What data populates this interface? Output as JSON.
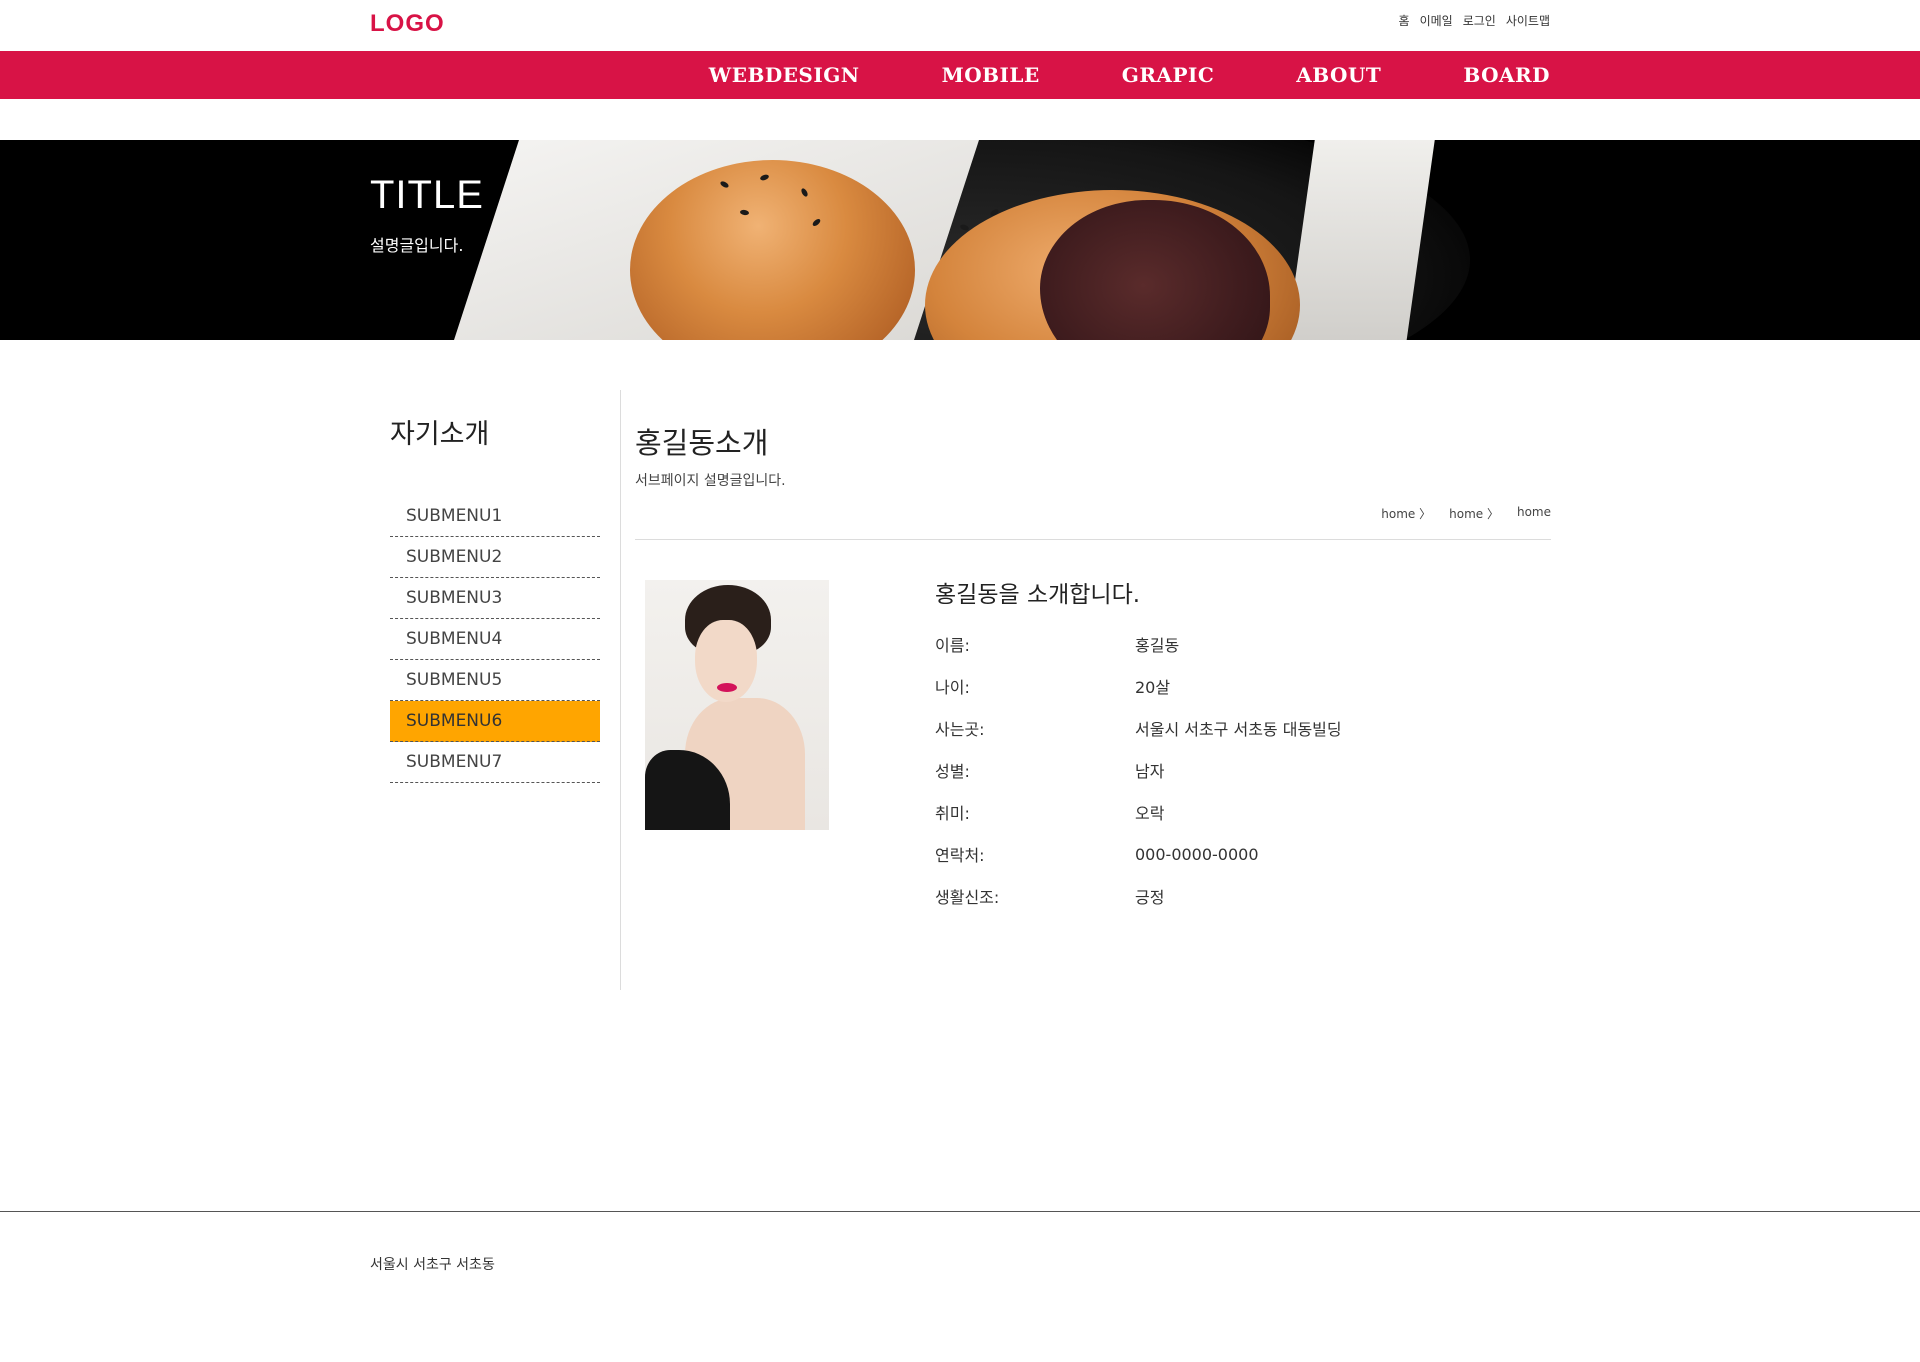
{
  "header": {
    "logo": "LOGO",
    "util_links": [
      "홈",
      "이메일",
      "로그인",
      "사이트맵"
    ],
    "nav": [
      "WEBDESIGN",
      "MOBILE",
      "GRAPIC",
      "ABOUT",
      "BOARD"
    ]
  },
  "banner": {
    "title": "TITLE",
    "description": "설명글입니다."
  },
  "sidebar": {
    "title": "자기소개",
    "items": [
      "SUBMENU1",
      "SUBMENU2",
      "SUBMENU3",
      "SUBMENU4",
      "SUBMENU5",
      "SUBMENU6",
      "SUBMENU7"
    ],
    "active_index": 5
  },
  "main": {
    "title": "홍길동소개",
    "subtitle": "서브페이지 설명글입니다.",
    "breadcrumb": [
      "home 〉",
      "home 〉",
      "home"
    ],
    "profile": {
      "heading": "홍길동을 소개합니다.",
      "rows": [
        {
          "label": "이름:",
          "value": "홍길동"
        },
        {
          "label": "나이:",
          "value": "20살"
        },
        {
          "label": "사는곳:",
          "value": "서울시 서초구 서초동 대동빌딩"
        },
        {
          "label": "성별:",
          "value": "남자"
        },
        {
          "label": "취미:",
          "value": "오락"
        },
        {
          "label": "연락처:",
          "value": "000-0000-0000"
        },
        {
          "label": "생활신조:",
          "value": "긍정"
        }
      ]
    }
  },
  "footer": {
    "address": "서울시 서초구 서초동"
  },
  "colors": {
    "brand": "#d81346",
    "active_menu": "#ffa500"
  }
}
